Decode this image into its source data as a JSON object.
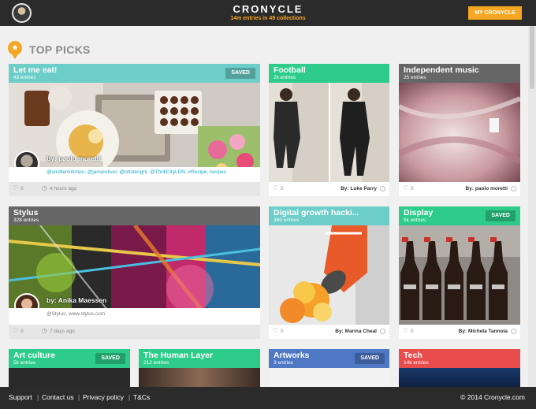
{
  "header": {
    "brand": "CRONYCLE",
    "stats": "14m entries in 49 collections",
    "my_button": "MY CRONYCLE"
  },
  "section": {
    "title": "TOP PICKS"
  },
  "saved_label": "SAVED",
  "cards": [
    {
      "title": "Let me eat!",
      "count": "43 entries",
      "saved": true,
      "author": "by: paolo moretti",
      "tags": "@smittenkitchen, @jamieoliver, @ottolenghi, @ThrillCityLDN, #Recipe, recipes",
      "likes": "0",
      "time": "4 hours ago",
      "color": "#6ccdc9"
    },
    {
      "title": "Football",
      "count": "2k entries",
      "saved": false,
      "likes": "0",
      "by": "By: Luke Parry",
      "color": "#2ecc8a"
    },
    {
      "title": "Independent music",
      "count": "25 entries",
      "saved": false,
      "likes": "0",
      "by": "By: paolo moretti",
      "color": "#666666"
    },
    {
      "title": "Stylus",
      "count": "328 entries",
      "saved": false,
      "author": "by: Anika Maessen",
      "tags": "@Stylus, www.stylus.com",
      "likes": "0",
      "time": "7 days ago",
      "color": "#666666"
    },
    {
      "title": "Digital growth hacki...",
      "count": "369 entries",
      "saved": false,
      "likes": "0",
      "by": "By: Marina Cheal",
      "color": "#6ccdc9"
    },
    {
      "title": "Display",
      "count": "5k entries",
      "saved": true,
      "likes": "0",
      "by": "By: Michela Tannoia",
      "color": "#2ecc8a"
    },
    {
      "title": "Art culture",
      "count": "5k entries",
      "saved": true,
      "color": "#2ecc8a"
    },
    {
      "title": "The Human Layer",
      "count": "212 entries",
      "saved": false,
      "color": "#2ecc8a"
    },
    {
      "title": "Artworks",
      "count": "3 entries",
      "saved": true,
      "color": "#4f78c4"
    },
    {
      "title": "Tech",
      "count": "14k entries",
      "saved": false,
      "color": "#e84c4c"
    }
  ],
  "footer": {
    "links": [
      "Support",
      "Contact us",
      "Privacy policy",
      "T&Cs"
    ],
    "copyright": "© 2014 Cronycle.com"
  },
  "icons": [
    "avatar",
    "star-badge-icon",
    "heart-icon",
    "clock-icon",
    "status-dot-icon"
  ]
}
